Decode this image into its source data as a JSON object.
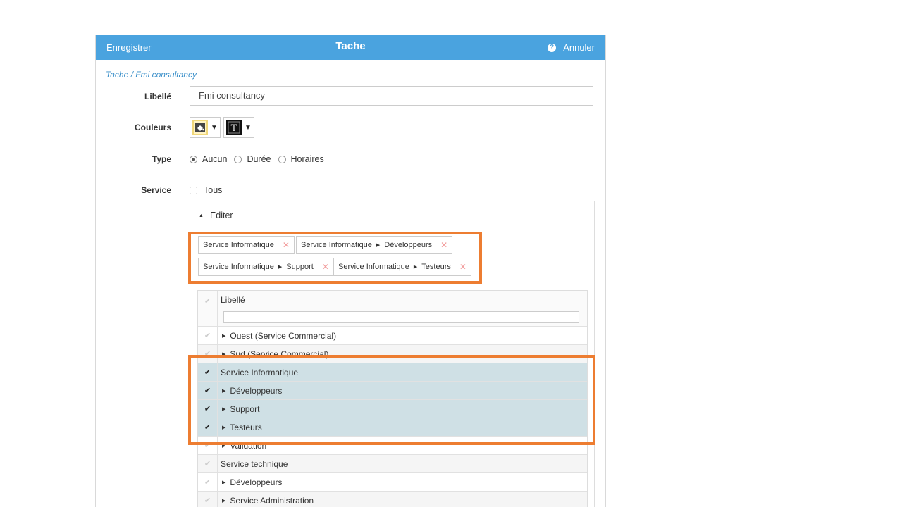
{
  "header": {
    "save_label": "Enregistrer",
    "title": "Tache",
    "cancel_label": "Annuler",
    "bar_color": "#4aa3df"
  },
  "breadcrumb": "Tache / Fmi consultancy",
  "form": {
    "libelle_label": "Libellé",
    "libelle_value": "Fmi consultancy",
    "couleurs_label": "Couleurs",
    "type_label": "Type",
    "type_options": [
      "Aucun",
      "Durée",
      "Horaires"
    ],
    "type_selected": "Aucun",
    "service_label": "Service",
    "service_all_label": "Tous"
  },
  "service_panel": {
    "toggle_label": "Editer",
    "tags": [
      {
        "parent": "Service Informatique",
        "child": ""
      },
      {
        "parent": "Service Informatique",
        "child": "Développeurs"
      },
      {
        "parent": "Service Informatique",
        "child": "Support"
      },
      {
        "parent": "Service Informatique",
        "child": "Testeurs"
      }
    ],
    "grid": {
      "column_header": "Libellé",
      "rows": [
        {
          "text": "Ouest (Service Commercial)",
          "child": true,
          "selected": false
        },
        {
          "text": "Sud (Service Commercial)",
          "child": true,
          "selected": false
        },
        {
          "text": "Service Informatique",
          "child": false,
          "selected": true
        },
        {
          "text": "Développeurs",
          "child": true,
          "selected": true
        },
        {
          "text": "Support",
          "child": true,
          "selected": true
        },
        {
          "text": "Testeurs",
          "child": true,
          "selected": true
        },
        {
          "text": "Validation",
          "child": true,
          "selected": false
        },
        {
          "text": "Service technique",
          "child": false,
          "selected": false
        },
        {
          "text": "Développeurs",
          "child": true,
          "selected": false
        },
        {
          "text": "Service Administration",
          "child": true,
          "selected": false
        }
      ]
    }
  },
  "colors": {
    "highlight": "#ed7d31",
    "selected_row": "#cfe0e5"
  }
}
